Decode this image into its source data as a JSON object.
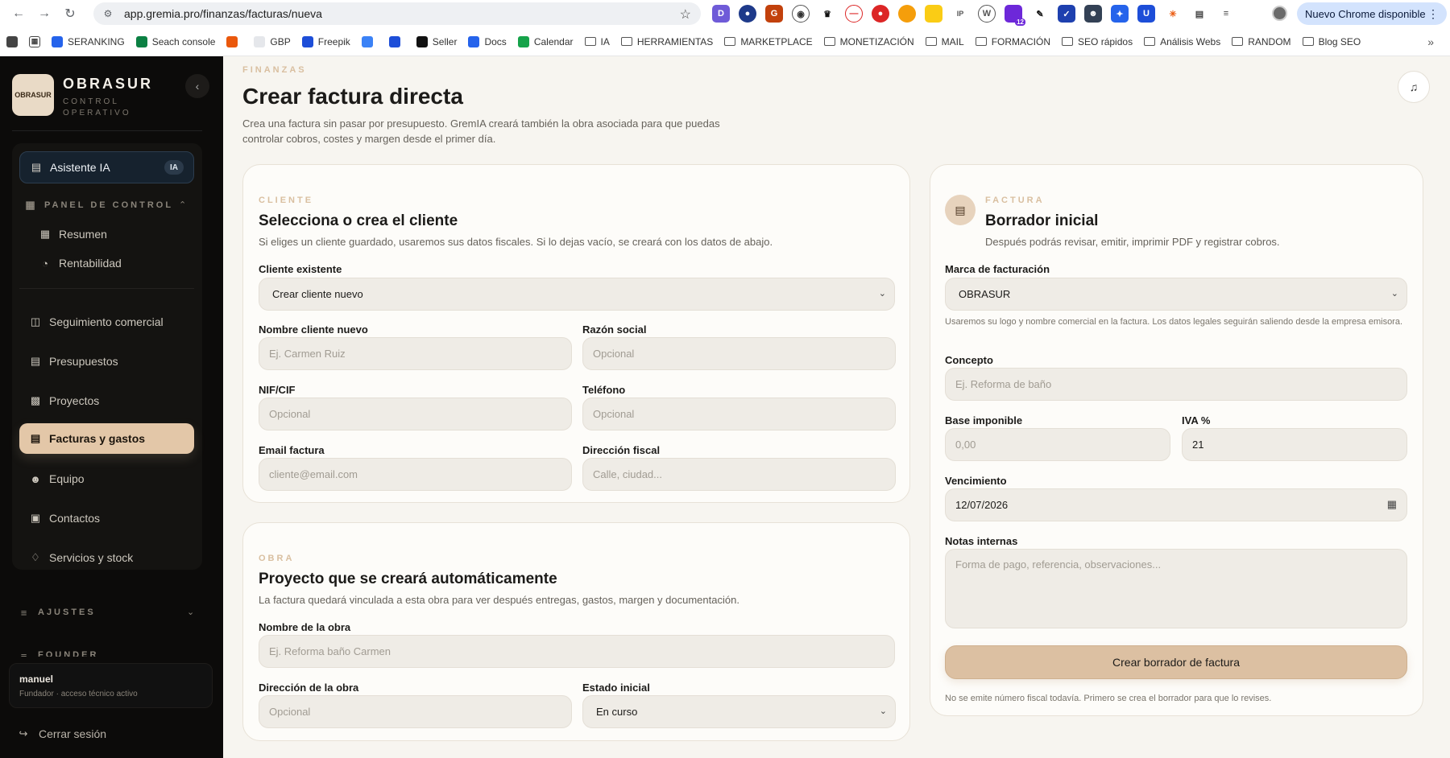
{
  "browser": {
    "url": "app.gremia.pro/finanzas/facturas/nueva",
    "update_label": "Nuevo Chrome disponible",
    "bookmarks": [
      {
        "label": "SERANKING",
        "type": "site"
      },
      {
        "label": "Seach console",
        "type": "site"
      },
      {
        "label": "",
        "type": "site"
      },
      {
        "label": "GBP",
        "type": "site"
      },
      {
        "label": "Freepik",
        "type": "site"
      },
      {
        "label": "",
        "type": "site"
      },
      {
        "label": "",
        "type": "site"
      },
      {
        "label": "Seller",
        "type": "site"
      },
      {
        "label": "Docs",
        "type": "site"
      },
      {
        "label": "Calendar",
        "type": "site"
      },
      {
        "label": "IA",
        "type": "folder"
      },
      {
        "label": "HERRAMIENTAS",
        "type": "folder"
      },
      {
        "label": "MARKETPLACE",
        "type": "folder"
      },
      {
        "label": "MONETIZACIÓN",
        "type": "folder"
      },
      {
        "label": "MAIL",
        "type": "folder"
      },
      {
        "label": "FORMACIÓN",
        "type": "folder"
      },
      {
        "label": "SEO rápidos",
        "type": "folder"
      },
      {
        "label": "Análisis Webs",
        "type": "folder"
      },
      {
        "label": "RANDOM",
        "type": "folder"
      },
      {
        "label": "Blog SEO",
        "type": "folder"
      }
    ],
    "extension_badge": "12"
  },
  "sidebar": {
    "brand": "OBRASUR",
    "brand_sub": "CONTROL OPERATIVO",
    "logo_text": "OBRASUR",
    "assistant": {
      "label": "Asistente IA",
      "badge": "IA"
    },
    "panel_heading": "PANEL DE CONTROL",
    "sub_items": [
      {
        "label": "Resumen",
        "icon": "grid-icon"
      },
      {
        "label": "Rentabilidad",
        "icon": "pie-chart-icon"
      }
    ],
    "items": [
      {
        "label": "Seguimiento comercial",
        "icon": "columns-icon"
      },
      {
        "label": "Presupuestos",
        "icon": "document-icon"
      },
      {
        "label": "Proyectos",
        "icon": "building-icon"
      },
      {
        "label": "Facturas y gastos",
        "icon": "invoice-icon",
        "active": true
      },
      {
        "label": "Equipo",
        "icon": "users-icon"
      },
      {
        "label": "Contactos",
        "icon": "contact-icon"
      },
      {
        "label": "Servicios y stock",
        "icon": "tag-icon"
      }
    ],
    "settings_heading": "AJUSTES",
    "founder_heading": "FOUNDER",
    "user": {
      "name": "manuel",
      "role": "Fundador · acceso técnico activo"
    },
    "logout": "Cerrar sesión"
  },
  "page": {
    "kicker": "FINANZAS",
    "title": "Crear factura directa",
    "description": "Crea una factura sin pasar por presupuesto. GremIA creará también la obra asociada para que puedas controlar cobros, costes y margen desde el primer día."
  },
  "client": {
    "kicker": "CLIENTE",
    "title": "Selecciona o crea el cliente",
    "description": "Si eliges un cliente guardado, usaremos sus datos fiscales. Si lo dejas vacío, se creará con los datos de abajo.",
    "existing_label": "Cliente existente",
    "existing_value": "Crear cliente nuevo",
    "name_label": "Nombre cliente nuevo",
    "name_placeholder": "Ej. Carmen Ruiz",
    "company_label": "Razón social",
    "company_placeholder": "Opcional",
    "nif_label": "NIF/CIF",
    "nif_placeholder": "Opcional",
    "phone_label": "Teléfono",
    "phone_placeholder": "Opcional",
    "email_label": "Email factura",
    "email_placeholder": "cliente@email.com",
    "address_label": "Dirección fiscal",
    "address_placeholder": "Calle, ciudad..."
  },
  "project": {
    "kicker": "OBRA",
    "title": "Proyecto que se creará automáticamente",
    "description": "La factura quedará vinculada a esta obra para ver después entregas, gastos, margen y documentación.",
    "name_label": "Nombre de la obra",
    "name_placeholder": "Ej. Reforma baño Carmen",
    "address_label": "Dirección de la obra",
    "address_placeholder": "Opcional",
    "status_label": "Estado inicial",
    "status_value": "En curso"
  },
  "invoice": {
    "kicker": "FACTURA",
    "title": "Borrador inicial",
    "description": "Después podrás revisar, emitir, imprimir PDF y registrar cobros.",
    "brand_label": "Marca de facturación",
    "brand_value": "OBRASUR",
    "brand_hint": "Usaremos su logo y nombre comercial en la factura. Los datos legales seguirán saliendo desde la empresa emisora.",
    "concept_label": "Concepto",
    "concept_placeholder": "Ej. Reforma de baño",
    "base_label": "Base imponible",
    "base_placeholder": "0,00",
    "vat_label": "IVA %",
    "vat_value": "21",
    "due_label": "Vencimiento",
    "due_value": "12/07/2026",
    "notes_label": "Notas internas",
    "notes_placeholder": "Forma de pago, referencia, observaciones...",
    "submit_label": "Crear borrador de factura",
    "footer_note": "No se emite número fiscal todavía. Primero se crea el borrador para que lo revises."
  },
  "colors": {
    "accent": "#dcc0a2",
    "sidebar_bg": "#0c0b0a",
    "page_bg": "#f7f5f0"
  }
}
